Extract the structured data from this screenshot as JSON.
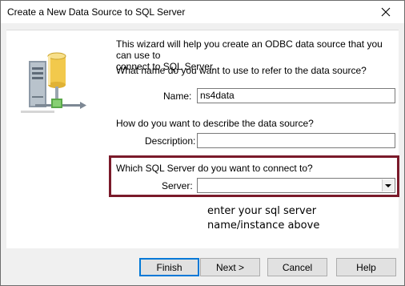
{
  "window": {
    "title": "Create a New Data Source to SQL Server"
  },
  "wizard": {
    "intro_line1": "This wizard will help you create an ODBC data source that you can use to",
    "intro_line2": "connect to SQL Server.",
    "name_question": "What name do you want to use to refer to the data source?",
    "name_label": "Name:",
    "name_value": "ns4data",
    "description_question": "How do you want to describe the data source?",
    "description_label": "Description:",
    "description_value": "",
    "server_question": "Which SQL Server do you want to connect to?",
    "server_label": "Server:",
    "server_value": ""
  },
  "annotation": {
    "line1": "enter your sql server",
    "line2": "name/instance above",
    "highlight_color": "#7a1a2a"
  },
  "buttons": {
    "finish": "Finish",
    "next": "Next >",
    "cancel": "Cancel",
    "help": "Help"
  },
  "icons": [
    "close-icon",
    "server-database-icon",
    "dropdown-arrow-icon"
  ]
}
